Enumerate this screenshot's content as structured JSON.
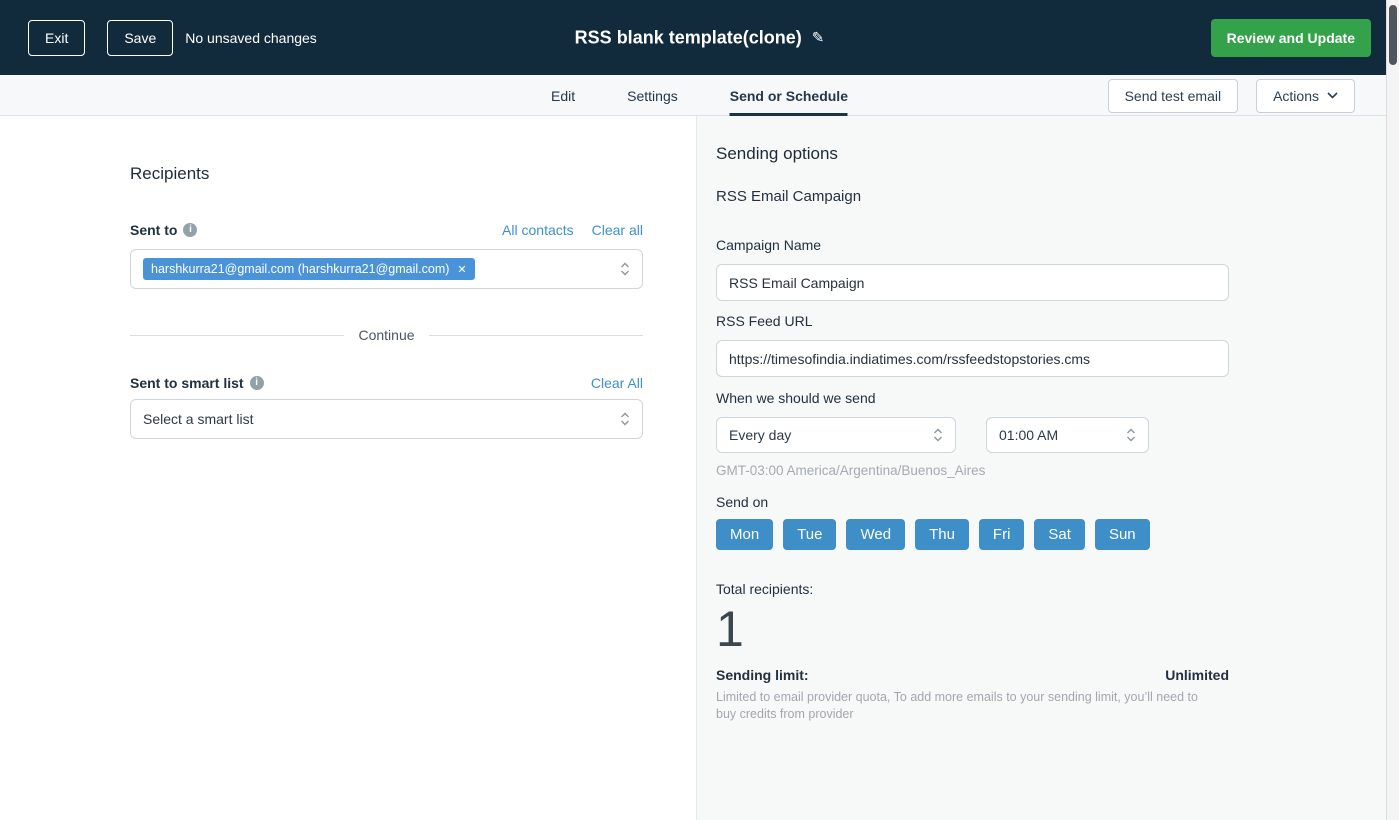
{
  "header": {
    "exit_label": "Exit",
    "save_label": "Save",
    "status_text": "No unsaved changes",
    "title": "RSS blank template(clone)",
    "review_button": "Review and Update"
  },
  "tabs": {
    "items": [
      {
        "label": "Edit",
        "active": false
      },
      {
        "label": "Settings",
        "active": false
      },
      {
        "label": "Send or Schedule",
        "active": true
      }
    ],
    "send_test_label": "Send test email",
    "actions_label": "Actions"
  },
  "recipients": {
    "heading": "Recipients",
    "sent_to_label": "Sent to",
    "all_contacts_link": "All contacts",
    "clear_all_link": "Clear all",
    "recipient_chip": "harshkurra21@gmail.com (harshkurra21@gmail.com)",
    "continue_label": "Continue",
    "smart_list_label": "Sent to smart list",
    "smart_clear_all_link": "Clear All",
    "smart_list_placeholder": "Select a smart list"
  },
  "sending_options": {
    "heading": "Sending options",
    "subheading": "RSS Email Campaign",
    "campaign_name_label": "Campaign Name",
    "campaign_name_value": "RSS Email Campaign",
    "rss_feed_label": "RSS Feed URL",
    "rss_feed_value": "https://timesofindia.indiatimes.com/rssfeedstopstories.cms",
    "when_label": "When we should we send",
    "frequency_value": "Every day",
    "time_value": "01:00 AM",
    "timezone_text": "GMT-03:00 America/Argentina/Buenos_Aires",
    "send_on_label": "Send on",
    "days": [
      "Mon",
      "Tue",
      "Wed",
      "Thu",
      "Fri",
      "Sat",
      "Sun"
    ],
    "total_recipients_label": "Total recipients:",
    "total_recipients_value": "1",
    "sending_limit_label": "Sending limit:",
    "sending_limit_value": "Unlimited",
    "sending_limit_note": "Limited to email provider quota, To add more emails to your sending limit, you’ll need to buy credits from provider"
  },
  "colors": {
    "topbar_bg": "#112b3c",
    "accent_green": "#34a24a",
    "accent_blue": "#3e8fd0",
    "chip_blue": "#4b93d8",
    "day_button_blue": "#3e8ec7",
    "right_panel_bg": "#f7f8f8"
  }
}
